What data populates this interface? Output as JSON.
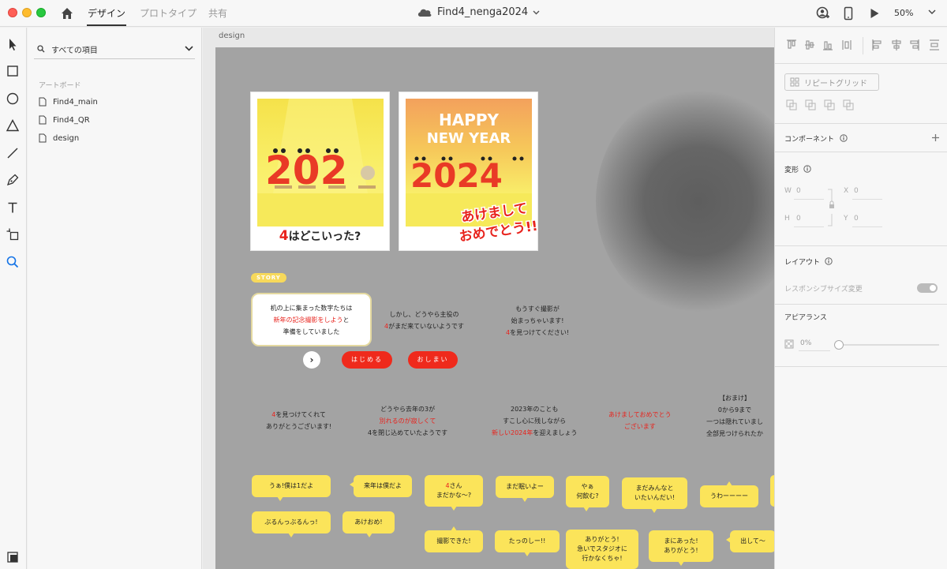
{
  "header": {
    "tabs": [
      {
        "label": "デザイン",
        "active": true
      },
      {
        "label": "プロトタイプ",
        "active": false
      },
      {
        "label": "共有",
        "active": false
      }
    ],
    "doc_title": "Find4_nenga2024",
    "zoom": "50%"
  },
  "layers": {
    "search_placeholder": "すべての項目",
    "section_label": "アートボード",
    "items": [
      "Find4_main",
      "Find4_QR",
      "design"
    ]
  },
  "canvas": {
    "artboard_name": "design",
    "photo1": {
      "number": "202",
      "caption_red": "4",
      "caption_rest": "はどこいった?"
    },
    "photo2": {
      "headline_1": "HAPPY",
      "headline_2": "NEW YEAR",
      "number": "2024",
      "greeting_1": "あけまして",
      "greeting_2": "おめでとう!!"
    },
    "story_badge": "STORY",
    "story": {
      "box_l1": "机の上に集まった数字たちは",
      "box_l2_red": "新年の記念撮影をしよう",
      "box_l2_rest": "と",
      "box_l3": "準備をしていました",
      "t2_l1": "しかし、どうやら主役の",
      "t2_l2_red": "4",
      "t2_l2_rest": "がまだ来ていないようです",
      "t3_l1": "もうすぐ撮影が",
      "t3_l2": "始まっちゃいます!",
      "t3_l3_red": "4",
      "t3_l3_rest": "を見つけてください!"
    },
    "buttons": {
      "next": "›",
      "start": "はじめる",
      "end": "おしまい"
    },
    "results": {
      "r1_l1_red": "4",
      "r1_l1_rest": "を見つけてくれて",
      "r1_l2": "ありがとうございます!",
      "r2_l1": "どうやら去年の3が",
      "r2_l2_red": "別れるのが寂しくて",
      "r2_l3": "4を閉じ込めていたようです",
      "r3_l1": "2023年のことも",
      "r3_l2": "すこし心に残しながら",
      "r3_l3_red": "新しい2024年",
      "r3_l3_rest": "を迎えましょう",
      "r4_l1": "あけましておめでとう",
      "r4_l2": "ございます",
      "r5_l1": "【おまけ】",
      "r5_l2": "0から9まで",
      "r5_l3": "一つは隠れていまし",
      "r5_l4": "全部見つけられたか"
    },
    "bubbles": {
      "b1": "うぁ!僕は1だよ",
      "b2": "来年は僕だよ",
      "b3": "ぶるんっぶるんっ!",
      "b4": "あけおめ!",
      "b5_red": "4",
      "b5_l1_rest": "さん",
      "b5_l2": "まだかな〜?",
      "b6": "まだ眠いよー",
      "b7_l1": "やぁ",
      "b7_l2": "何飲む?",
      "b8_l1": "まだみんなと",
      "b8_l2": "いたいんだい!",
      "b9": "うわーーーー",
      "b10": "撮影できた!",
      "b11": "たっのしー!!",
      "b12_l1": "ありがとう!",
      "b12_l2": "急いでスタジオに",
      "b12_l3": "行かなくちゃ!",
      "b13_l1": "まにあった!",
      "b13_l2": "ありがとう!",
      "b14": "出して〜"
    }
  },
  "props": {
    "repeat_grid": "リピートグリッド",
    "component": "コンポーネント",
    "transform": "変形",
    "w_label": "W",
    "w_value": "0",
    "x_label": "X",
    "x_value": "0",
    "h_label": "H",
    "h_value": "0",
    "y_label": "Y",
    "y_value": "0",
    "layout": "レイアウト",
    "responsive": "レスポンシブサイズ変更",
    "appearance": "アピアランス",
    "opacity": "0%"
  },
  "colors": {
    "accent_red": "#ef2a1c",
    "bubble_yellow": "#fbe45a",
    "artboard_gray": "#a3a3a3"
  }
}
